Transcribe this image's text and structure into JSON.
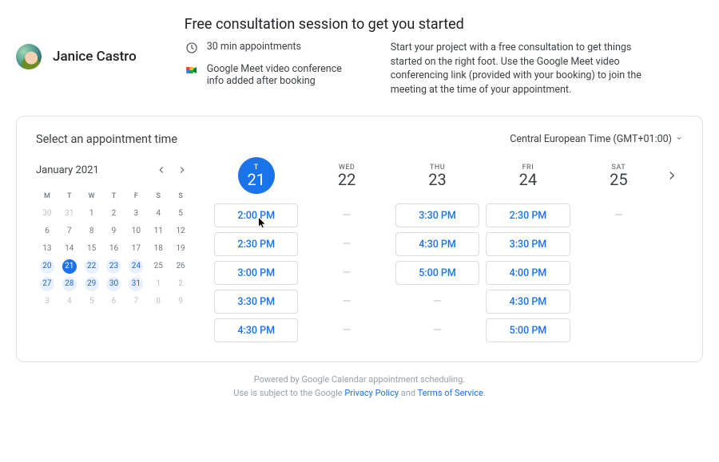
{
  "owner": {
    "name": "Janice Castro"
  },
  "session": {
    "title": "Free consultation session to get you started",
    "duration_label": "30 min appointments",
    "meet_label": "Google Meet video conference info added after booking",
    "description": "Start your project with a free consultation to get things started on the right foot. Use the Google Meet video conferencing link (provided with your booking) to join the meeting at the time of your appointment."
  },
  "scheduling": {
    "heading": "Select an appointment time",
    "timezone_label": "Central European Time (GMT+01:00)"
  },
  "minical": {
    "month_label": "January 2021",
    "dow": [
      "M",
      "T",
      "W",
      "T",
      "F",
      "S",
      "S"
    ],
    "weeks": [
      [
        {
          "n": "30",
          "dim": true
        },
        {
          "n": "31",
          "dim": true
        },
        {
          "n": "1"
        },
        {
          "n": "2"
        },
        {
          "n": "3"
        },
        {
          "n": "4"
        },
        {
          "n": "5"
        }
      ],
      [
        {
          "n": "6"
        },
        {
          "n": "7"
        },
        {
          "n": "8"
        },
        {
          "n": "9"
        },
        {
          "n": "10"
        },
        {
          "n": "11"
        },
        {
          "n": "12"
        }
      ],
      [
        {
          "n": "13"
        },
        {
          "n": "14"
        },
        {
          "n": "15"
        },
        {
          "n": "16"
        },
        {
          "n": "17"
        },
        {
          "n": "18"
        },
        {
          "n": "19"
        }
      ],
      [
        {
          "n": "20",
          "avail": true
        },
        {
          "n": "21",
          "sel": true
        },
        {
          "n": "22",
          "avail": true
        },
        {
          "n": "23",
          "avail": true
        },
        {
          "n": "24",
          "avail": true
        },
        {
          "n": "25"
        },
        {
          "n": "26"
        }
      ],
      [
        {
          "n": "27",
          "avail": true
        },
        {
          "n": "28",
          "avail": true
        },
        {
          "n": "29",
          "avail": true
        },
        {
          "n": "30",
          "avail": true
        },
        {
          "n": "31",
          "avail": true
        },
        {
          "n": "1",
          "dim": true
        },
        {
          "n": "2",
          "dim": true
        }
      ],
      [
        {
          "n": "3",
          "dim": true
        },
        {
          "n": "4",
          "dim": true
        },
        {
          "n": "5",
          "dim": true
        },
        {
          "n": "6",
          "dim": true
        },
        {
          "n": "7",
          "dim": true
        },
        {
          "n": "8",
          "dim": true
        },
        {
          "n": "9",
          "dim": true
        }
      ]
    ]
  },
  "days": [
    {
      "wd": "T",
      "num": "21",
      "active": true,
      "slots": [
        "2:00 PM",
        "2:30 PM",
        "3:00 PM",
        "3:30 PM",
        "4:30 PM"
      ]
    },
    {
      "wd": "WED",
      "num": "22",
      "slots": []
    },
    {
      "wd": "THU",
      "num": "23",
      "slots": [
        "3:30 PM",
        "4:30 PM",
        "5:00 PM"
      ]
    },
    {
      "wd": "FRI",
      "num": "24",
      "slots": [
        "2:30 PM",
        "3:30 PM",
        "4:00 PM",
        "4:30 PM",
        "5:00 PM"
      ]
    },
    {
      "wd": "SAT",
      "num": "25",
      "slots": []
    }
  ],
  "footer": {
    "line1": "Powered by Google Calendar appointment scheduling.",
    "line2_pre": "Use is subject to the Google ",
    "privacy": "Privacy Policy",
    "and": " and ",
    "tos": "Terms of Service",
    "dot": "."
  }
}
